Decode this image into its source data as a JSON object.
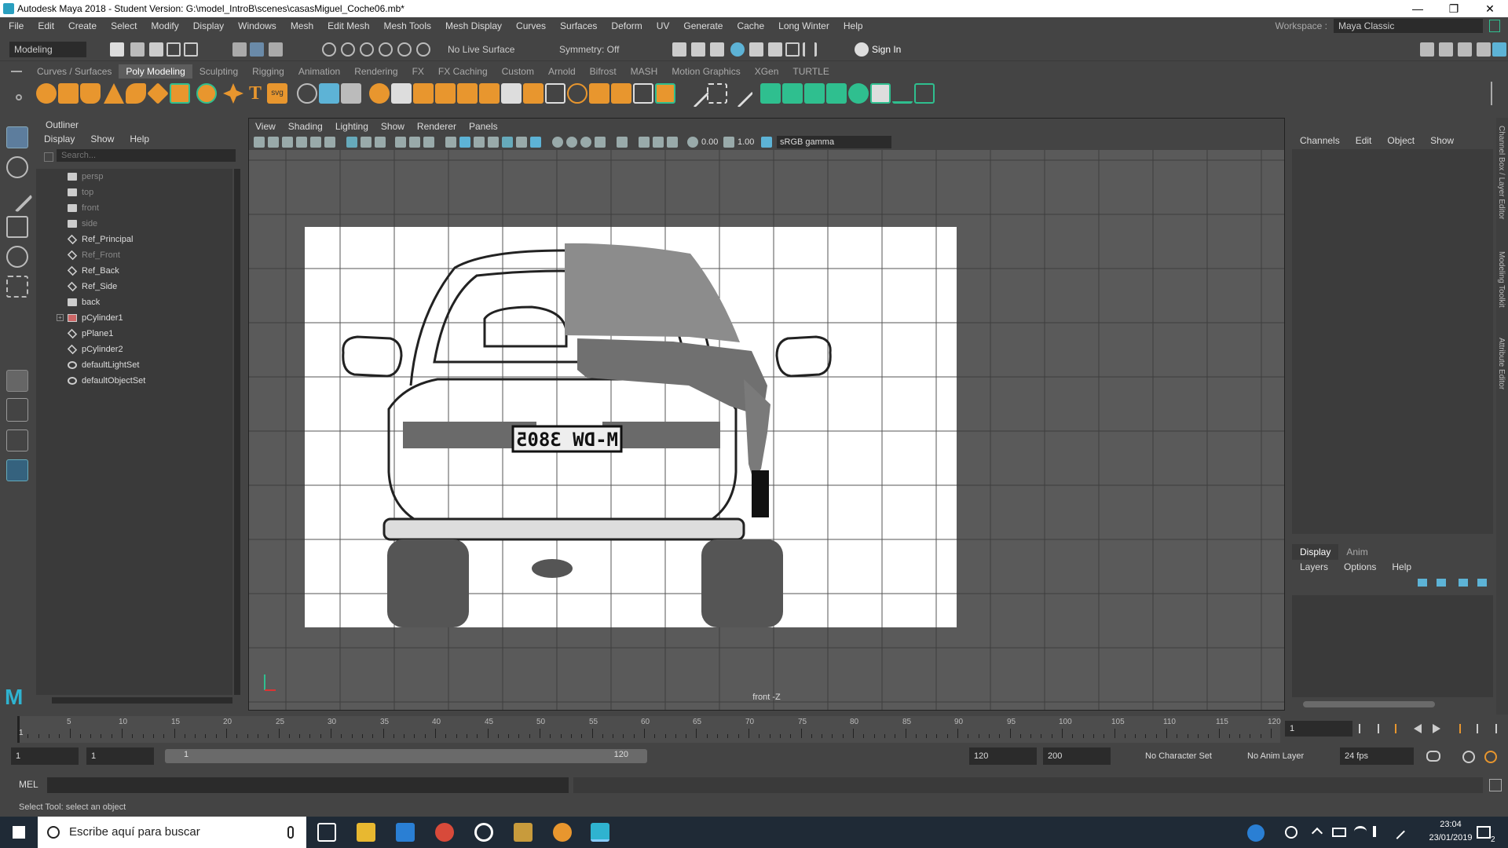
{
  "window": {
    "title": "Autodesk Maya 2018 - Student Version: G:\\model_IntroB\\scenes\\casasMiguel_Coche06.mb*",
    "minimize": "—",
    "restore": "❐",
    "close": "✕"
  },
  "menubar": {
    "items": [
      "File",
      "Edit",
      "Create",
      "Select",
      "Modify",
      "Display",
      "Windows",
      "Mesh",
      "Edit Mesh",
      "Mesh Tools",
      "Mesh Display",
      "Curves",
      "Surfaces",
      "Deform",
      "UV",
      "Generate",
      "Cache",
      "Long Winter",
      "Help"
    ],
    "workspace_label": "Workspace :",
    "workspace_value": "Maya Classic"
  },
  "statusline": {
    "mode": "Modeling",
    "live_surface": "No Live Surface",
    "symmetry": "Symmetry: Off",
    "sign_in": "Sign In"
  },
  "shelf": {
    "tabs": [
      "Curves / Surfaces",
      "Poly Modeling",
      "Sculpting",
      "Rigging",
      "Animation",
      "Rendering",
      "FX",
      "FX Caching",
      "Custom",
      "Arnold",
      "Bifrost",
      "MASH",
      "Motion Graphics",
      "XGen",
      "TURTLE"
    ],
    "active_tab": "Poly Modeling",
    "text_icon": "T",
    "svg_icon": "svg"
  },
  "outliner": {
    "title": "Outliner",
    "menu": [
      "Display",
      "Show",
      "Help"
    ],
    "search_placeholder": "Search...",
    "items": [
      {
        "label": "persp",
        "icon": "camera-icon",
        "dim": true
      },
      {
        "label": "top",
        "icon": "camera-icon",
        "dim": true
      },
      {
        "label": "front",
        "icon": "camera-icon",
        "dim": true
      },
      {
        "label": "side",
        "icon": "camera-icon",
        "dim": true
      },
      {
        "label": "Ref_Principal",
        "icon": "transform-icon",
        "dim": false
      },
      {
        "label": "Ref_Front",
        "icon": "transform-icon",
        "dim": true
      },
      {
        "label": "Ref_Back",
        "icon": "transform-icon",
        "dim": false
      },
      {
        "label": "Ref_Side",
        "icon": "transform-icon",
        "dim": false
      },
      {
        "label": "back",
        "icon": "camera-icon",
        "dim": false
      },
      {
        "label": "pCylinder1",
        "icon": "group-icon",
        "dim": false,
        "expandable": true
      },
      {
        "label": "pPlane1",
        "icon": "transform-icon",
        "dim": false
      },
      {
        "label": "pCylinder2",
        "icon": "transform-icon",
        "dim": false
      },
      {
        "label": "defaultLightSet",
        "icon": "set-icon",
        "dim": false
      },
      {
        "label": "defaultObjectSet",
        "icon": "set-icon",
        "dim": false
      }
    ]
  },
  "viewport": {
    "menu": [
      "View",
      "Shading",
      "Lighting",
      "Show",
      "Renderer",
      "Panels"
    ],
    "exposure": "0.00",
    "gamma": "1.00",
    "color_space": "sRGB gamma",
    "camera_label": "front -Z",
    "plate_text": "M-DW 3805"
  },
  "channelbox": {
    "menu": [
      "Channels",
      "Edit",
      "Object",
      "Show"
    ],
    "side_tabs": [
      "Channel Box / Layer Editor",
      "Modeling Toolkit",
      "Attribute Editor"
    ]
  },
  "layereditor": {
    "tabs": [
      "Display",
      "Anim"
    ],
    "active_tab": "Display",
    "menu": [
      "Layers",
      "Options",
      "Help"
    ]
  },
  "timeslider": {
    "ticks": [
      "5",
      "10",
      "15",
      "20",
      "25",
      "30",
      "35",
      "40",
      "45",
      "50",
      "55",
      "60",
      "65",
      "70",
      "75",
      "80",
      "85",
      "90",
      "95",
      "100",
      "105",
      "110",
      "115",
      "120"
    ],
    "current_marker": "1",
    "current_frame": "1"
  },
  "rangeslider": {
    "start": "1",
    "playback_start": "1",
    "range_start": "1",
    "range_end": "120",
    "playback_end": "120",
    "end": "200",
    "character_set": "No Character Set",
    "anim_layer": "No Anim Layer",
    "fps": "24 fps"
  },
  "cmdline": {
    "label": "MEL"
  },
  "helpline": {
    "text": "Select Tool: select an object"
  },
  "taskbar": {
    "search_placeholder": "Escribe aquí para buscar",
    "time": "23:04",
    "date": "23/01/2019",
    "notification_count": "2"
  },
  "colors": {
    "maya_bg": "#444444",
    "field_bg": "#2b2b2b",
    "shelf_orange": "#e8962e",
    "shelf_green": "#2fbf8f",
    "taskbar": "#1f2a36"
  }
}
